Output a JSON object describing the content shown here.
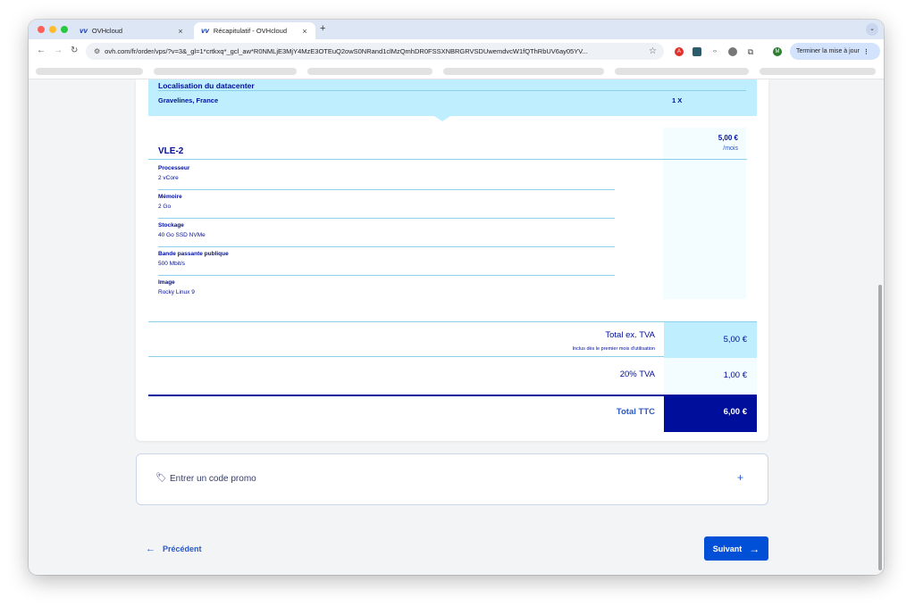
{
  "browser": {
    "tabs": [
      {
        "title": "OVHcloud",
        "close": "×"
      },
      {
        "title": "Récapitulatif - OVHcloud",
        "close": "×"
      }
    ],
    "new_tab": "+",
    "url": "ovh.com/fr/order/vps/?v=3&_gl=1*crtkxq*_gcl_aw*R0NMLjE3MjY4MzE3OTEuQ2owS0NRand1clMzQmhDR0FSSXNBRGRVSDUwemdvcW1fQThRbUV6ay05YV...",
    "update_button": "Terminer la mise à jour"
  },
  "datacenter": {
    "label": "Localisation du datacenter",
    "value": "Gravelines, France",
    "quantity": "1 X"
  },
  "plan": {
    "name": "VLE-2",
    "price": "5,00 €",
    "period": "/mois",
    "specs": [
      {
        "label": "Processeur",
        "value": "2 vCore"
      },
      {
        "label": "Mémoire",
        "value": "2 Go"
      },
      {
        "label": "Stockage",
        "value": "40 Go SSD NVMe"
      },
      {
        "label": "Bande passante publique",
        "value": "500 Mbit/s"
      },
      {
        "label": "Image",
        "value": "Rocky Linux 9"
      }
    ]
  },
  "totals": {
    "ex_vat_label": "Total ex. TVA",
    "ex_vat_note": "Inclus dès le premier mois d'utilisation",
    "ex_vat_value": "5,00 €",
    "vat_label": "20% TVA",
    "vat_value": "1,00 €",
    "ttc_label": "Total TTC",
    "ttc_value": "6,00 €"
  },
  "promo": {
    "label": "Entrer un code promo",
    "toggle": "+"
  },
  "nav": {
    "previous": "Précédent",
    "next": "Suivant"
  }
}
